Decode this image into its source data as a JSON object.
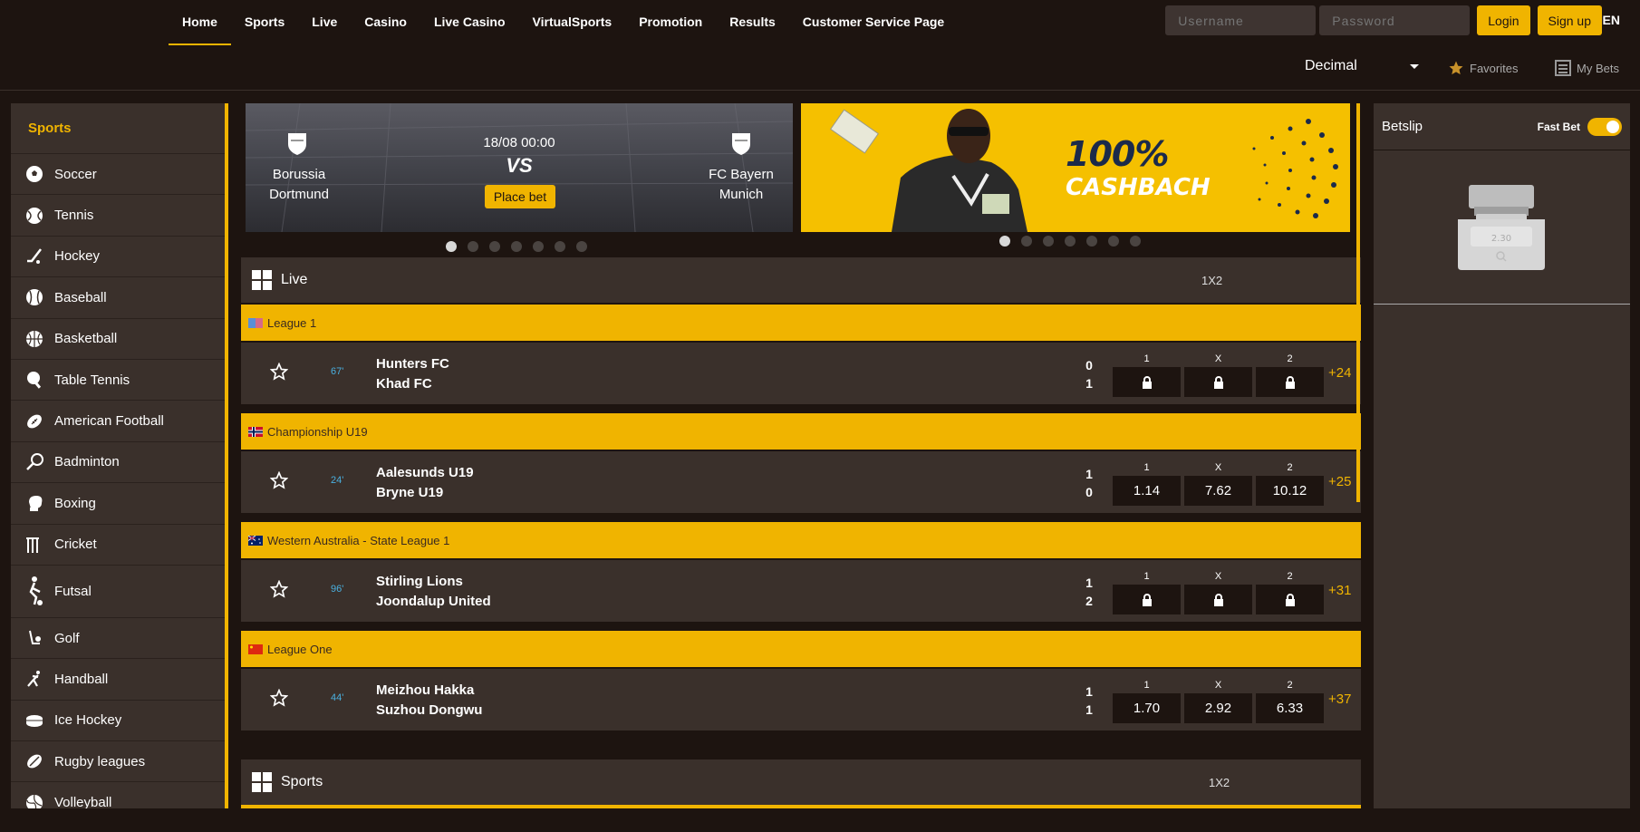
{
  "nav": {
    "items": [
      "Home",
      "Sports",
      "Live",
      "Casino",
      "Live Casino",
      "VirtualSports",
      "Promotion",
      "Results",
      "Customer Service Page"
    ],
    "active": "Home"
  },
  "auth": {
    "username_placeholder": "Username",
    "password_placeholder": "Password",
    "login": "Login",
    "signup": "Sign up",
    "lang": "EN"
  },
  "subbar": {
    "odds_format": "Decimal",
    "favorites": "Favorites",
    "my_bets": "My Bets"
  },
  "sidebar": {
    "title": "Sports",
    "items": [
      {
        "label": "Soccer",
        "icon": "soccer-ball-icon"
      },
      {
        "label": "Tennis",
        "icon": "tennis-ball-icon"
      },
      {
        "label": "Hockey",
        "icon": "hockey-stick-icon"
      },
      {
        "label": "Baseball",
        "icon": "baseball-icon"
      },
      {
        "label": "Basketball",
        "icon": "basketball-icon"
      },
      {
        "label": "Table Tennis",
        "icon": "table-tennis-icon"
      },
      {
        "label": "American Football",
        "icon": "american-football-icon"
      },
      {
        "label": "Badminton",
        "icon": "badminton-icon"
      },
      {
        "label": "Boxing",
        "icon": "boxing-glove-icon"
      },
      {
        "label": "Cricket",
        "icon": "cricket-icon"
      },
      {
        "label": "Futsal",
        "icon": "futsal-icon"
      },
      {
        "label": "Golf",
        "icon": "golf-icon"
      },
      {
        "label": "Handball",
        "icon": "handball-icon"
      },
      {
        "label": "Ice Hockey",
        "icon": "ice-hockey-puck-icon"
      },
      {
        "label": "Rugby leagues",
        "icon": "rugby-ball-icon"
      },
      {
        "label": "Volleyball",
        "icon": "volleyball-icon"
      }
    ]
  },
  "banner1": {
    "home": "Borussia Dortmund",
    "away": "FC Bayern Munich",
    "datetime": "18/08 00:00",
    "vs": "VS",
    "cta": "Place bet"
  },
  "banner2": {
    "line1": "100%",
    "line2": "CASHBACH"
  },
  "live": {
    "title": "Live",
    "market": "1X2",
    "odd_labels": [
      "1",
      "X",
      "2"
    ],
    "groups": [
      {
        "league": "League 1",
        "flag": "flag-icon",
        "matches": [
          {
            "minute": "67'",
            "home": "Hunters FC",
            "away": "Khad FC",
            "score_home": "0",
            "score_away": "1",
            "odds": [
              "lock",
              "lock",
              "lock"
            ],
            "more": "+24"
          }
        ]
      },
      {
        "league": "Championship U19",
        "flag": "norway-flag-icon",
        "matches": [
          {
            "minute": "24'",
            "home": "Aalesunds U19",
            "away": "Bryne U19",
            "score_home": "1",
            "score_away": "0",
            "odds": [
              "1.14",
              "7.62",
              "10.12"
            ],
            "more": "+25"
          }
        ]
      },
      {
        "league": "Western Australia - State League 1",
        "flag": "australia-flag-icon",
        "matches": [
          {
            "minute": "96'",
            "home": "Stirling Lions",
            "away": "Joondalup United",
            "score_home": "1",
            "score_away": "2",
            "odds": [
              "lock",
              "lock",
              "lock"
            ],
            "more": "+31"
          }
        ]
      },
      {
        "league": "League One",
        "flag": "china-flag-icon",
        "matches": [
          {
            "minute": "44'",
            "home": "Meizhou Hakka",
            "away": "Suzhou Dongwu",
            "score_home": "1",
            "score_away": "1",
            "odds": [
              "1.70",
              "2.92",
              "6.33"
            ],
            "more": "+37"
          }
        ]
      }
    ]
  },
  "sports_section": {
    "title": "Sports",
    "market": "1X2"
  },
  "betslip": {
    "title": "Betslip",
    "fast_bet": "Fast Bet",
    "fast_bet_on": true,
    "placeholder_odd": "2.30"
  },
  "colors": {
    "accent": "#f0b400",
    "bg": "#1d1410",
    "panel": "#3a302b",
    "minute": "#4ab0e0"
  }
}
